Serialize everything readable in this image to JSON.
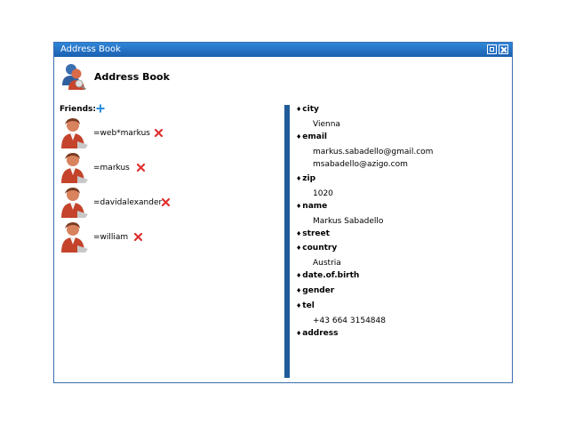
{
  "window": {
    "title": "Address Book"
  },
  "app": {
    "title": "Address Book"
  },
  "friends": {
    "label": "Friends:",
    "items": [
      {
        "name": "=web*markus"
      },
      {
        "name": "=markus"
      },
      {
        "name": "=davidalexander"
      },
      {
        "name": "=william"
      }
    ]
  },
  "details": {
    "fields": [
      {
        "label": "city",
        "values": [
          "Vienna"
        ]
      },
      {
        "label": "email",
        "values": [
          "markus.sabadello@gmail.com",
          "msabadello@azigo.com"
        ]
      },
      {
        "label": "zip",
        "values": [
          "1020"
        ]
      },
      {
        "label": "name",
        "values": [
          "Markus Sabadello"
        ]
      },
      {
        "label": "street",
        "values": []
      },
      {
        "label": "country",
        "values": [
          "Austria"
        ]
      },
      {
        "label": "date.of.birth",
        "values": []
      },
      {
        "label": "gender",
        "values": []
      },
      {
        "label": "tel",
        "values": [
          "+43 664 3154848"
        ]
      },
      {
        "label": "address",
        "values": []
      }
    ]
  },
  "colors": {
    "titlebar": "#1c5fb0",
    "divider": "#1f5c99",
    "add": "#2a8ee0",
    "delete": "#e03030"
  },
  "icons": {
    "app": "address-book-icon",
    "add": "plus-icon",
    "delete": "delete-x-icon",
    "avatar": "person-avatar-icon"
  }
}
